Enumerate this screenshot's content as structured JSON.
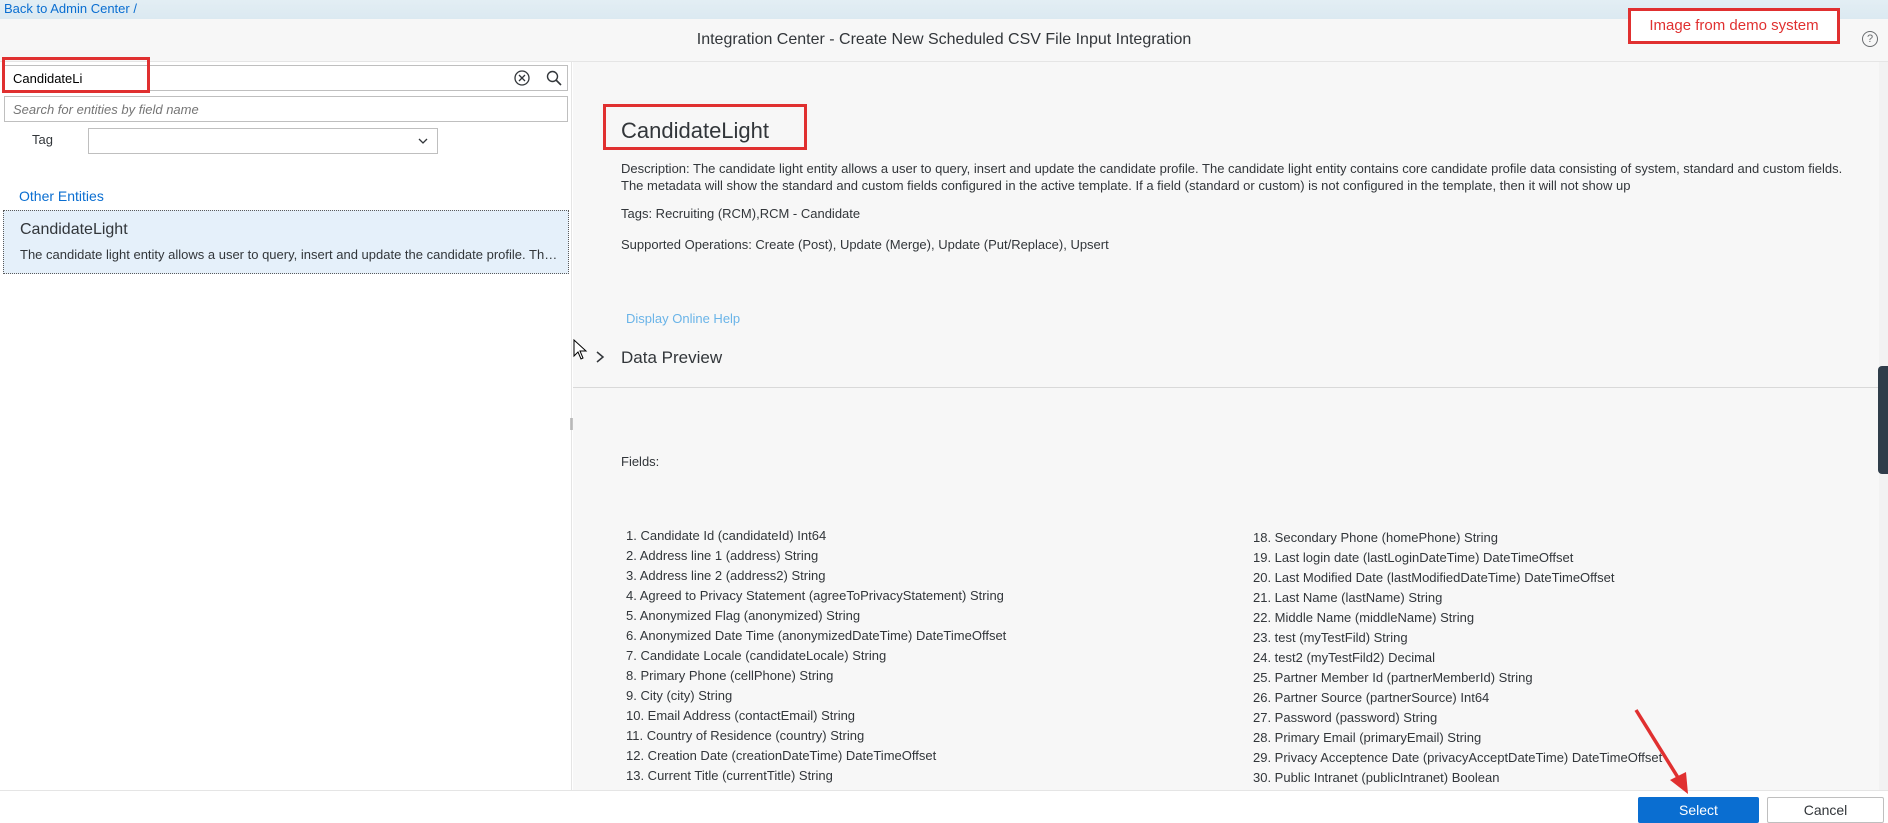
{
  "topbar": {
    "back_link": "Back to Admin Center /"
  },
  "header": {
    "title": "Integration Center - Create New Scheduled CSV File Input Integration",
    "demo_badge": "Image from demo system",
    "help_icon": "question-circle-icon"
  },
  "left": {
    "search_value": "CandidateLi",
    "field_search_placeholder": "Search for entities by field name",
    "tag_label": "Tag",
    "tag_value": "",
    "group_label": "Other Entities",
    "entity": {
      "title": "CandidateLight",
      "description": "The candidate light entity allows a user to query, insert and update the candidate profile. The candidate light entity contains core candidate profile data"
    }
  },
  "right": {
    "heading": "CandidateLight",
    "description": "Description: The candidate light entity allows a user to query, insert and update the candidate profile. The candidate light entity contains core candidate profile data consisting of system, standard and custom fields. The metadata will show the standard and custom fields configured in the active template. If a field (standard or custom) is not configured in the template, then it will not show up",
    "tags": "Tags: Recruiting (RCM),RCM - Candidate",
    "operations": "Supported Operations: Create (Post), Update (Merge), Update (Put/Replace), Upsert",
    "online_help": "Display Online Help",
    "data_preview": "Data Preview",
    "fields_label": "Fields:",
    "fields_col1": [
      "1. Candidate Id (candidateId) Int64",
      "2. Address line 1 (address) String",
      "3. Address line 2 (address2) String",
      "4. Agreed to Privacy Statement (agreeToPrivacyStatement) String",
      "5. Anonymized Flag (anonymized) String",
      "6. Anonymized Date Time (anonymizedDateTime) DateTimeOffset",
      "7. Candidate Locale (candidateLocale) String",
      "8. Primary Phone (cellPhone) String",
      "9. City (city) String",
      "10. Email Address (contactEmail) String",
      "11. Country of Residence (country) String",
      "12. Creation Date (creationDateTime) DateTimeOffset",
      "13. Current Title (currentTitle) String"
    ],
    "fields_col2": [
      "18. Secondary Phone (homePhone) String",
      "19. Last login date (lastLoginDateTime) DateTimeOffset",
      "20. Last Modified Date (lastModifiedDateTime) DateTimeOffset",
      "21. Last Name (lastName) String",
      "22. Middle Name (middleName) String",
      "23. test (myTestFild) String",
      "24. test2 (myTestFild2) Decimal",
      "25. Partner Member Id (partnerMemberId) String",
      "26. Partner Source (partnerSource) Int64",
      "27. Password (password) String",
      "28. Primary Email (primaryEmail) String",
      "29. Privacy Acceptence Date (privacyAcceptDateTime) DateTimeOffset",
      "30. Public Intranet (publicIntranet) Boolean"
    ]
  },
  "footer": {
    "select_label": "Select",
    "cancel_label": "Cancel"
  },
  "colors": {
    "accent": "#0a6ed1",
    "annotation": "#e03030"
  }
}
